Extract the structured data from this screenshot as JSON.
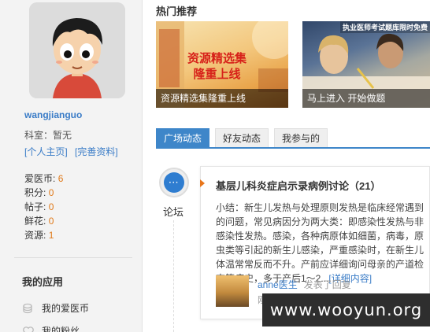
{
  "sidebar": {
    "username": "wangjianguo",
    "department": "科室：暂无",
    "profile_links": [
      "[个人主页]",
      "[完善资料]"
    ],
    "stats": [
      {
        "label": "爱医币:",
        "value": "6"
      },
      {
        "label": "积分:",
        "value": "0"
      },
      {
        "label": "帖子:",
        "value": "0"
      },
      {
        "label": "鲜花:",
        "value": "0"
      },
      {
        "label": "资源:",
        "value": "1"
      }
    ],
    "apps_title": "我的应用",
    "apps": [
      {
        "label": "我的爱医币",
        "icon": "coins-icon"
      },
      {
        "label": "我的粉丝",
        "icon": "heart-icon"
      }
    ]
  },
  "hot": {
    "title": "热门推荐",
    "cards": [
      {
        "caption": "资源精选集隆重上线",
        "promo_line1": "资源精选集",
        "promo_line2": "隆重上线"
      },
      {
        "caption": "马上进入  开始做题",
        "banner": "执业医师考试题库限时免费"
      }
    ]
  },
  "tabs": [
    "广场动态",
    "好友动态",
    "我参与的"
  ],
  "feed": {
    "category_label": "论坛",
    "category_icon_text": "···",
    "post": {
      "title": "基层儿科炎症启示录病例讨论（21）",
      "body": "小结：新生儿发热与处理原则发热是临床经常遇到的问题，常见病因分为两大类：即感染性发热与非感染性发热。感染，各种病原体如细菌，病毒，原虫类等引起的新生儿感染，严重感染时，在新生儿体温常常反而不升。产前应详细询问母亲的产道检查等病史，多于产后1～2...",
      "more": "[详细内容]",
      "author": "anne医生",
      "action": "发表了回复",
      "time": "刚刚"
    }
  },
  "watermark": "www.wooyun.org"
}
